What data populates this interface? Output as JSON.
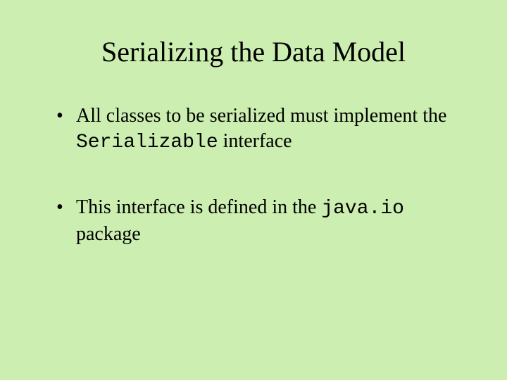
{
  "title": "Serializing the Data Model",
  "bullets": [
    {
      "pre": "All classes to be serialized must implement the ",
      "code": "Serializable",
      "post": " interface"
    },
    {
      "pre": "This interface is defined in the ",
      "code": "java.io",
      "post": " package"
    }
  ]
}
